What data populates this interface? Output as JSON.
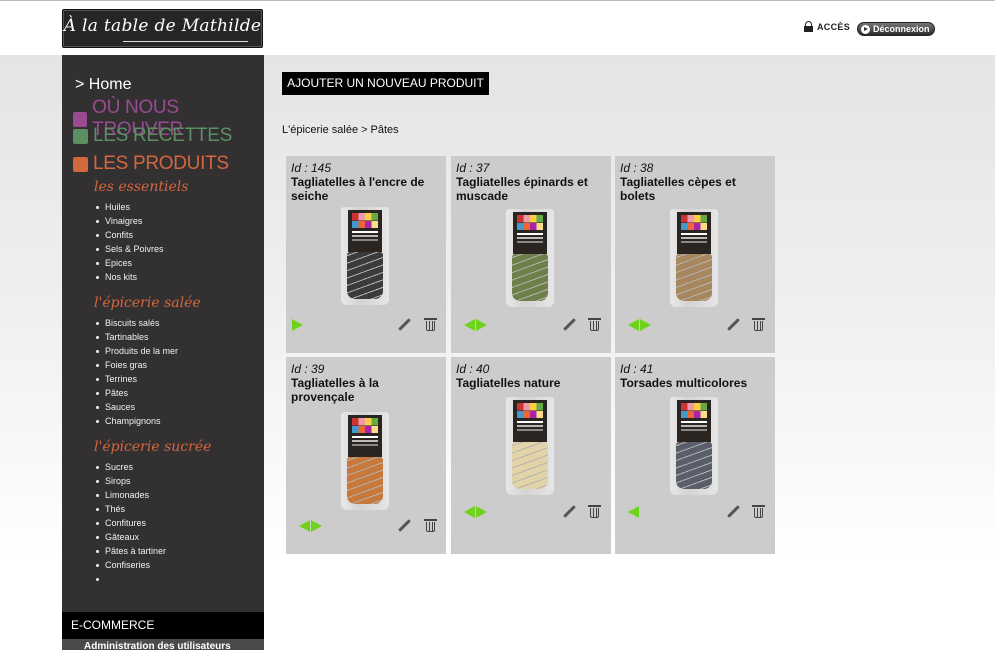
{
  "header": {
    "logo_text": "À la table de Mathilde",
    "acces_label": "ACCÈS",
    "logout_label": "Déconnexion"
  },
  "sidebar": {
    "home": "> Home",
    "sections": [
      "OÙ NOUS TROUVER",
      "LES RECETTES",
      "LES PRODUITS"
    ],
    "categories": [
      {
        "title": "les essentiels",
        "items": [
          "Huiles",
          "Vinaigres",
          "Confits",
          "Sels & Poivres",
          "Epices",
          "Nos kits"
        ]
      },
      {
        "title": "l'épicerie salée",
        "items": [
          "Biscuits salés",
          "Tartinables",
          "Produits de la mer",
          "Foies gras",
          "Terrines",
          "Pâtes",
          "Sauces",
          "Champignons"
        ]
      },
      {
        "title": "l'épicerie sucrée",
        "items": [
          "Sucres",
          "Sirops",
          "Limonades",
          "Thés",
          "Confitures",
          "Gâteaux",
          "Pâtes à tartiner",
          "Confiseries",
          ""
        ]
      }
    ],
    "ecommerce_label": "E-COMMERCE",
    "admin_label": "Administration des utilisateurs"
  },
  "main": {
    "add_button": "AJOUTER UN NOUVEAU PRODUIT",
    "breadcrumb": [
      "L'épicerie salée",
      ">",
      "Pâtes"
    ],
    "products": [
      {
        "id_label": "Id : 145",
        "name": "Tagliatelles à l'encre de seiche",
        "color": "#3b3b3b",
        "arrows": "right"
      },
      {
        "id_label": "Id : 37",
        "name": "Tagliatelles épinards et muscade",
        "color": "#6f7f4a",
        "arrows": "both"
      },
      {
        "id_label": "Id : 38",
        "name": "Tagliatelles cèpes et bolets",
        "color": "#a8875e",
        "arrows": "both"
      },
      {
        "id_label": "Id : 39",
        "name": "Tagliatelles à la provençale",
        "color": "#c8783a",
        "arrows": "both"
      },
      {
        "id_label": "Id : 40",
        "name": "Tagliatelles nature",
        "color": "#e3d3a8",
        "arrows": "both"
      },
      {
        "id_label": "Id : 41",
        "name": "Torsades multicolores",
        "color": "#5a5e6a",
        "arrows": "left"
      }
    ]
  }
}
